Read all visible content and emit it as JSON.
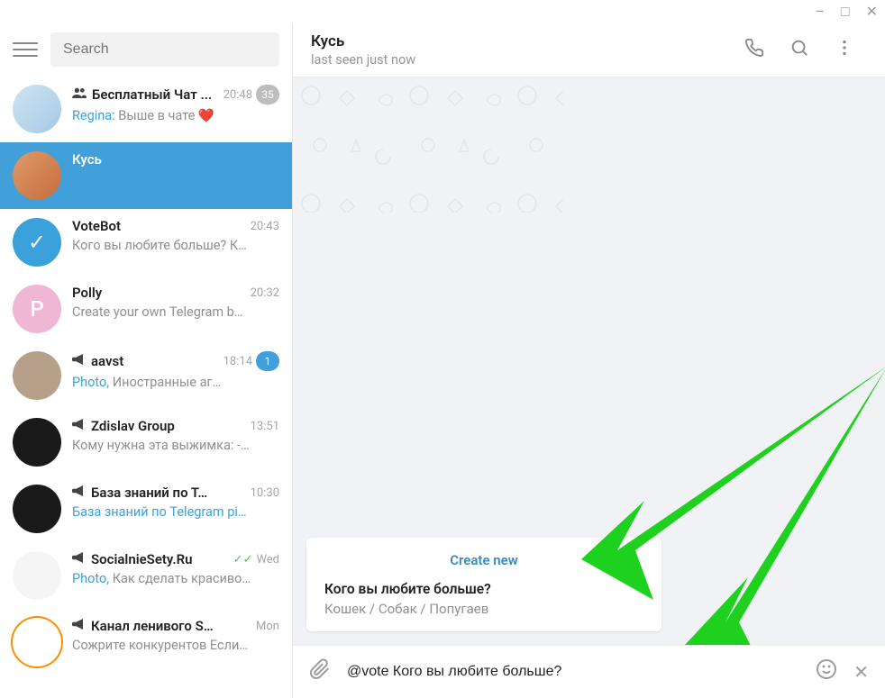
{
  "window": {
    "minimize": "–",
    "maximize": "□",
    "close": "✕"
  },
  "sidebar": {
    "search_placeholder": "Search",
    "items": [
      {
        "title": "Бесплатный Чат ...",
        "time": "20:48",
        "icon": "group",
        "sender": "Regina:",
        "msg": " Выше в чате ❤️",
        "badge": "35",
        "badge_blue": false,
        "avatar_bg": "linear-gradient(135deg,#cde5f0,#a7c8e6)",
        "avatar_txt": ""
      },
      {
        "title": "Кусь",
        "time": "",
        "icon": "",
        "sender": "",
        "msg": "",
        "badge": "",
        "active": true,
        "avatar_bg": "linear-gradient(135deg,#e09a6a,#c56d3d)",
        "avatar_txt": ""
      },
      {
        "title": "VoteBot",
        "time": "20:43",
        "icon": "",
        "sender": "",
        "msg": "Кого вы любите больше?  К…",
        "avatar_bg": "#3ba1db",
        "avatar_txt": "✓"
      },
      {
        "title": "Polly",
        "time": "20:32",
        "icon": "",
        "sender": "",
        "msg": "Create your own Telegram b…",
        "avatar_bg": "#efb7d3",
        "avatar_txt": "P"
      },
      {
        "title": "aavst",
        "time": "18:14",
        "icon": "channel",
        "sender": "",
        "link": "Photo, ",
        "msg": "Иностранные аг…",
        "badge": "1",
        "badge_blue": true,
        "avatar_bg": "#b7a08a",
        "avatar_txt": ""
      },
      {
        "title": "Zdislav Group",
        "time": "13:51",
        "icon": "channel",
        "sender": "",
        "msg": "Кому нужна эта выжимка:  -…",
        "avatar_bg": "#1a1a1a",
        "avatar_txt": ""
      },
      {
        "title": "База знаний по Т…",
        "time": "10:30",
        "icon": "channel",
        "sender": "",
        "link": "База знаний по Telegram pi…",
        "msg": "",
        "avatar_bg": "#1a1a1a",
        "avatar_txt": ""
      },
      {
        "title": "SocialnieSety.Ru",
        "time": "Wed",
        "icon": "channel",
        "sender": "",
        "link": "Photo, ",
        "msg": "Как сделать красиво…",
        "checks": "✓✓",
        "avatar_bg": "#f5f5f5",
        "avatar_txt": ""
      },
      {
        "title": "Канал ленивого S…",
        "time": "Mon",
        "icon": "channel",
        "sender": "",
        "msg": "Сожрите конкурентов  Если…",
        "avatar_bg": "#fff",
        "avatar_txt": "",
        "ring": true
      }
    ]
  },
  "header": {
    "title": "Кусь",
    "status": "last seen just now"
  },
  "popup": {
    "create": "Create new",
    "question": "Кого вы любите больше?",
    "options": "Кошек / Собак / Попугаев"
  },
  "composer": {
    "text": "@vote Кого вы любите больше?"
  }
}
